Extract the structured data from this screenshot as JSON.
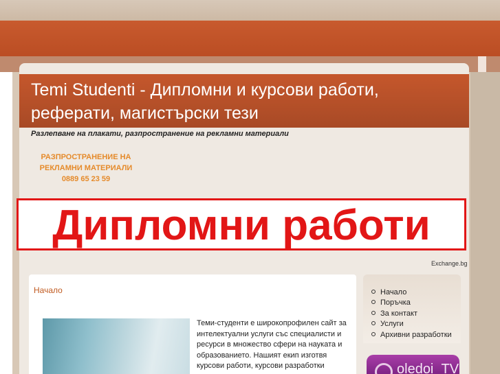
{
  "header": {
    "title": "Temi Studenti - Дипломни и курсови работи, реферати, магистърски тези",
    "tagline": "Разлепване на плакати, разпространение на рекламни материали"
  },
  "ad_left": {
    "line1": "РАЗПРОСТРАНЕНИЕ НА",
    "line2": "РЕКЛАМНИ МАТЕРИАЛИ",
    "phone": "0889 65 23 59"
  },
  "banner": {
    "text": "Дипломни работи",
    "color": "#e21616"
  },
  "exchange_label": "Exchange.bg",
  "content": {
    "title": "Начало",
    "body": "Теми-студенти е широкопрофилен сайт за интелектуални услуги със специалисти и ресурси в множество сфери на науката и образованието. Нашият екип изготвя курсови работи, курсови разработки"
  },
  "nav": {
    "items": [
      {
        "label": "Начало"
      },
      {
        "label": "Поръчка"
      },
      {
        "label": "За контакт"
      },
      {
        "label": "Услуги"
      },
      {
        "label": "Архивни разработки"
      }
    ]
  },
  "widget": {
    "label": "oledoi_TV",
    "icon": "play-icon"
  },
  "colors": {
    "accent": "#c05a20",
    "header": "#b5481f",
    "banner_red": "#e21616"
  }
}
